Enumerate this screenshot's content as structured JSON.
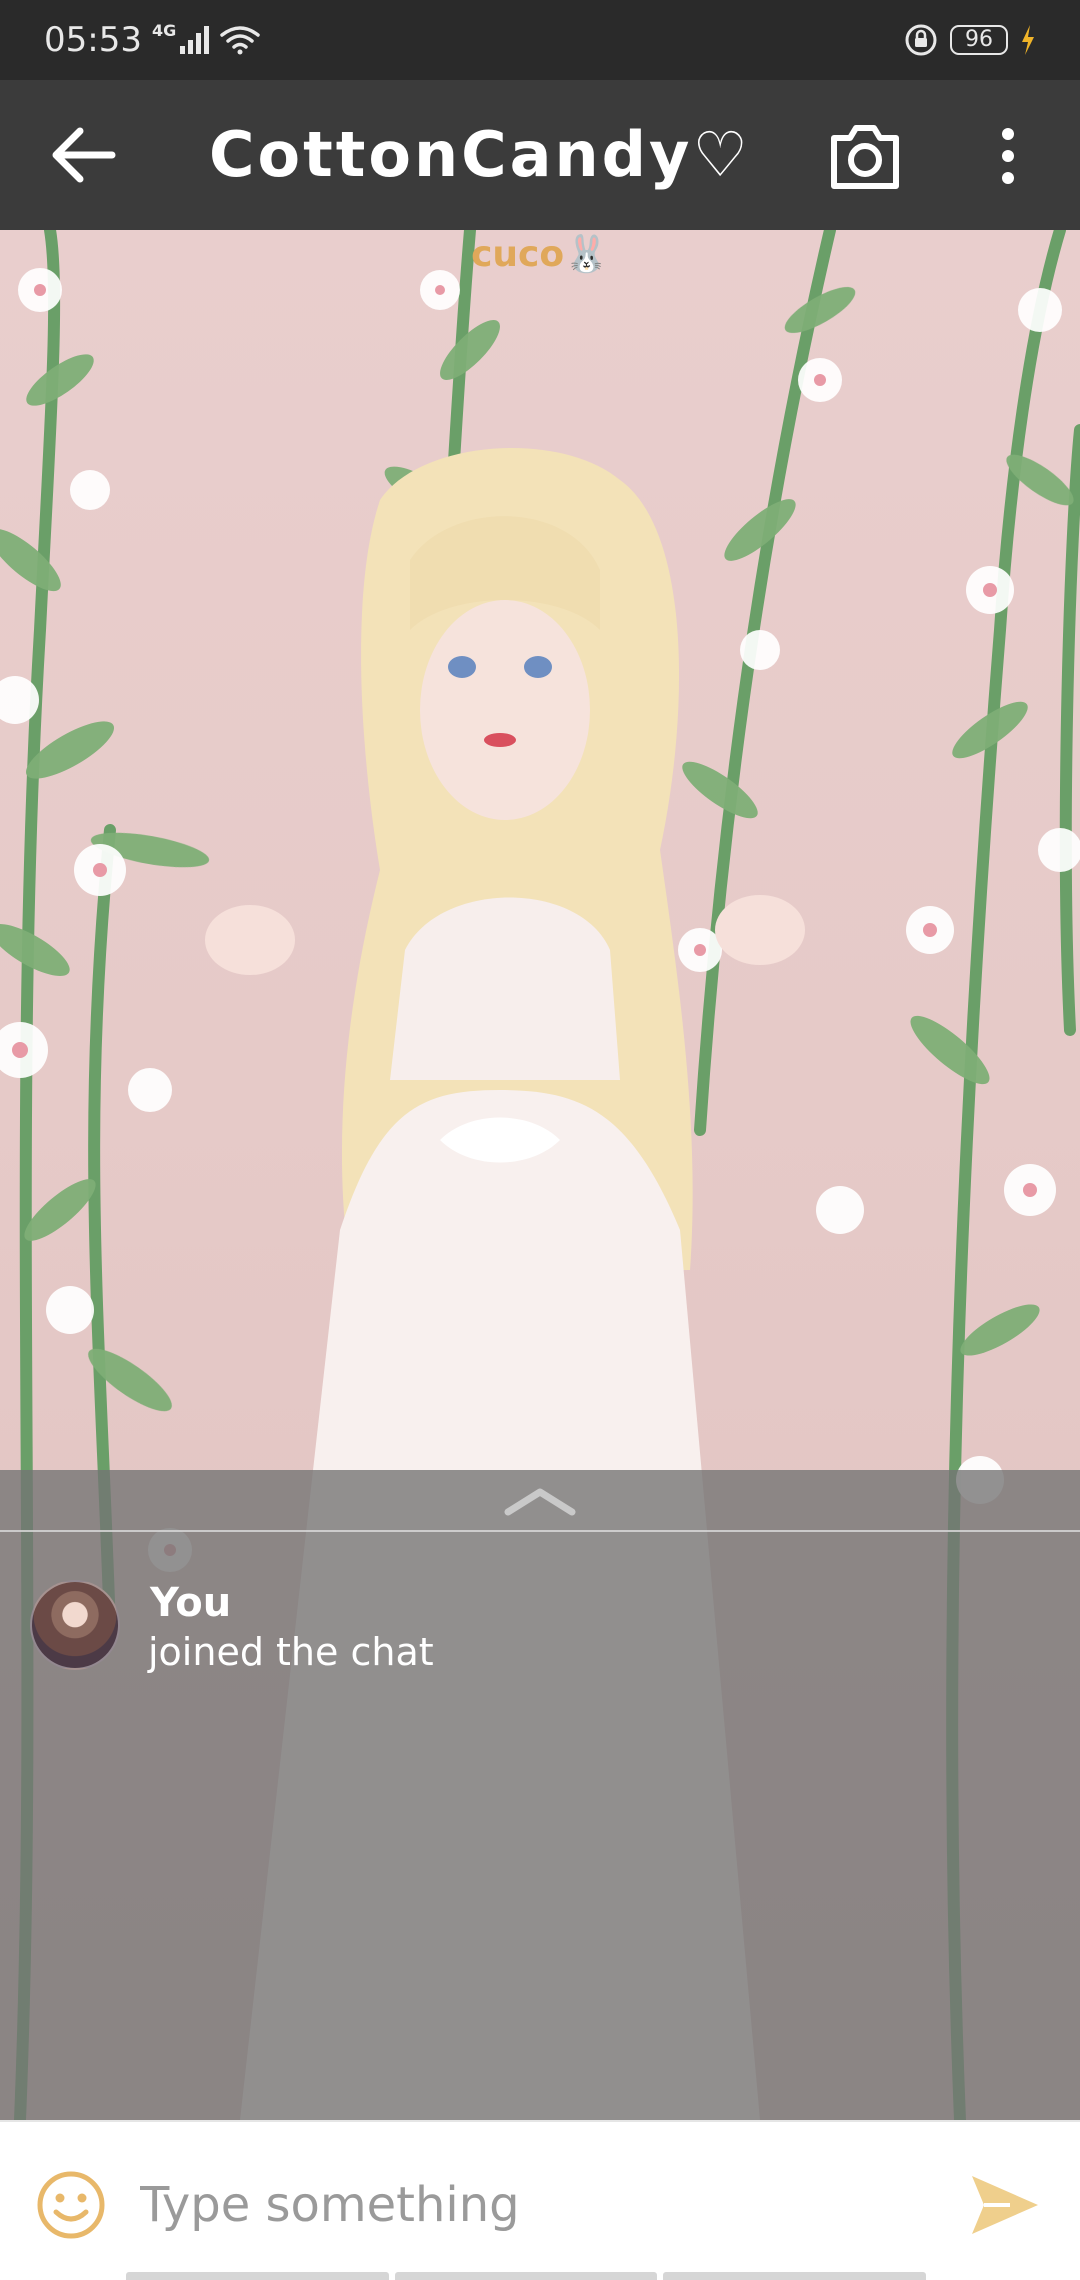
{
  "status_bar": {
    "time": "05:53",
    "network": "4G",
    "battery": "96"
  },
  "header": {
    "title": "CottonCandy♡",
    "icons": [
      "back-arrow-icon",
      "camera-icon",
      "more-vertical-icon"
    ]
  },
  "scene": {
    "room_name": "cuco🐰"
  },
  "chat": {
    "collapse_icon": "chevron-up-icon",
    "messages": [
      {
        "sender": "You",
        "text": "joined the chat"
      }
    ]
  },
  "input": {
    "placeholder": "Type something",
    "value": "",
    "emoji_icon": "smiley-icon",
    "send_icon": "send-icon"
  },
  "colors": {
    "status_bar": "#2a2a2a",
    "header": "#3b3b3b",
    "accent": "#e8b86a",
    "scene_bg": "#e9cecd",
    "chat_overlay": "#737373"
  }
}
